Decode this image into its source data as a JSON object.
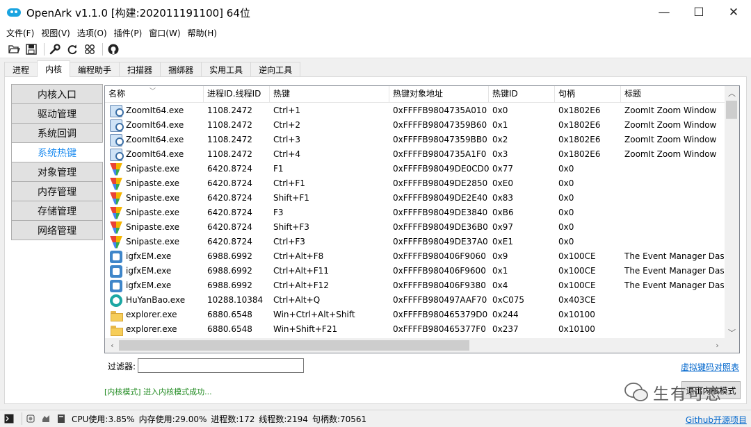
{
  "window": {
    "title": "OpenArk v1.1.0  [构建:202011191100]  64位",
    "controls": [
      "—",
      "☐",
      "✕"
    ]
  },
  "menu": [
    "文件(F)",
    "视图(V)",
    "选项(O)",
    "插件(P)",
    "窗口(W)",
    "帮助(H)"
  ],
  "toolbar": {
    "icons": [
      "open-folder-icon",
      "save-icon",
      "wrench-icon",
      "refresh-icon",
      "grid-icon",
      "github-icon"
    ]
  },
  "tabs": [
    "进程",
    "内核",
    "编程助手",
    "扫描器",
    "捆绑器",
    "实用工具",
    "逆向工具"
  ],
  "active_tab": "内核",
  "side_nav": [
    "内核入口",
    "驱动管理",
    "系统回调",
    "系统热键",
    "对象管理",
    "内存管理",
    "存储管理",
    "网络管理"
  ],
  "active_side": "系统热键",
  "grid": {
    "columns": [
      "名称",
      "进程ID.线程ID",
      "热键",
      "热键对象地址",
      "热键ID",
      "句柄",
      "标题"
    ],
    "rows": [
      {
        "icon": "zoomit",
        "name": "ZoomIt64.exe",
        "pid": "1108.2472",
        "hotkey": "Ctrl+1",
        "addr": "0xFFFFB9804735A010",
        "id": "0x0",
        "handle": "0x1802E6",
        "title": "ZoomIt Zoom Window"
      },
      {
        "icon": "zoomit",
        "name": "ZoomIt64.exe",
        "pid": "1108.2472",
        "hotkey": "Ctrl+2",
        "addr": "0xFFFFB98047359B60",
        "id": "0x1",
        "handle": "0x1802E6",
        "title": "ZoomIt Zoom Window"
      },
      {
        "icon": "zoomit",
        "name": "ZoomIt64.exe",
        "pid": "1108.2472",
        "hotkey": "Ctrl+3",
        "addr": "0xFFFFB98047359BB0",
        "id": "0x2",
        "handle": "0x1802E6",
        "title": "ZoomIt Zoom Window"
      },
      {
        "icon": "zoomit",
        "name": "ZoomIt64.exe",
        "pid": "1108.2472",
        "hotkey": "Ctrl+4",
        "addr": "0xFFFFB9804735A1F0",
        "id": "0x3",
        "handle": "0x1802E6",
        "title": "ZoomIt Zoom Window"
      },
      {
        "icon": "snipaste",
        "name": "Snipaste.exe",
        "pid": "6420.8724",
        "hotkey": "F1",
        "addr": "0xFFFFB98049DE0CD0",
        "id": "0x77",
        "handle": "0x0",
        "title": ""
      },
      {
        "icon": "snipaste",
        "name": "Snipaste.exe",
        "pid": "6420.8724",
        "hotkey": "Ctrl+F1",
        "addr": "0xFFFFB98049DE2850",
        "id": "0xE0",
        "handle": "0x0",
        "title": ""
      },
      {
        "icon": "snipaste",
        "name": "Snipaste.exe",
        "pid": "6420.8724",
        "hotkey": "Shift+F1",
        "addr": "0xFFFFB98049DE2E40",
        "id": "0x83",
        "handle": "0x0",
        "title": ""
      },
      {
        "icon": "snipaste",
        "name": "Snipaste.exe",
        "pid": "6420.8724",
        "hotkey": "F3",
        "addr": "0xFFFFB98049DE3840",
        "id": "0xB6",
        "handle": "0x0",
        "title": ""
      },
      {
        "icon": "snipaste",
        "name": "Snipaste.exe",
        "pid": "6420.8724",
        "hotkey": "Shift+F3",
        "addr": "0xFFFFB98049DE36B0",
        "id": "0x97",
        "handle": "0x0",
        "title": ""
      },
      {
        "icon": "snipaste",
        "name": "Snipaste.exe",
        "pid": "6420.8724",
        "hotkey": "Ctrl+F3",
        "addr": "0xFFFFB98049DE37A0",
        "id": "0xE1",
        "handle": "0x0",
        "title": ""
      },
      {
        "icon": "igfx",
        "name": "igfxEM.exe",
        "pid": "6988.6992",
        "hotkey": "Ctrl+Alt+F8",
        "addr": "0xFFFFB980406F9060",
        "id": "0x9",
        "handle": "0x100CE",
        "title": "The Event Manager Dashb"
      },
      {
        "icon": "igfx",
        "name": "igfxEM.exe",
        "pid": "6988.6992",
        "hotkey": "Ctrl+Alt+F11",
        "addr": "0xFFFFB980406F9600",
        "id": "0x1",
        "handle": "0x100CE",
        "title": "The Event Manager Dashb"
      },
      {
        "icon": "igfx",
        "name": "igfxEM.exe",
        "pid": "6988.6992",
        "hotkey": "Ctrl+Alt+F12",
        "addr": "0xFFFFB980406F9380",
        "id": "0x4",
        "handle": "0x100CE",
        "title": "The Event Manager Dashb"
      },
      {
        "icon": "huyan",
        "name": "HuYanBao.exe",
        "pid": "10288.10384",
        "hotkey": "Ctrl+Alt+Q",
        "addr": "0xFFFFB980497AAF70",
        "id": "0xC075",
        "handle": "0x403CE",
        "title": ""
      },
      {
        "icon": "folder",
        "name": "explorer.exe",
        "pid": "6880.6548",
        "hotkey": "Win+Ctrl+Alt+Shift",
        "addr": "0xFFFFB980465379D0",
        "id": "0x244",
        "handle": "0x10100",
        "title": ""
      },
      {
        "icon": "folder",
        "name": "explorer.exe",
        "pid": "6880.6548",
        "hotkey": "Win+Shift+F21",
        "addr": "0xFFFFB980465377F0",
        "id": "0x237",
        "handle": "0x10100",
        "title": ""
      }
    ]
  },
  "filter": {
    "label": "过滤器:",
    "value": "",
    "placeholder": ""
  },
  "keymap_link": "虚拟键码对照表",
  "status_message": "[内核模式] 进入内核模式成功...",
  "kernel_button": "退出内核模式",
  "watermark": "生有可恋",
  "statusbar": {
    "cpu": "CPU使用:3.85%",
    "mem": "内存使用:29.00%",
    "procs": "进程数:172",
    "threads": "线程数:2194",
    "handles": "句柄数:70561",
    "github": "Github开源项目"
  }
}
